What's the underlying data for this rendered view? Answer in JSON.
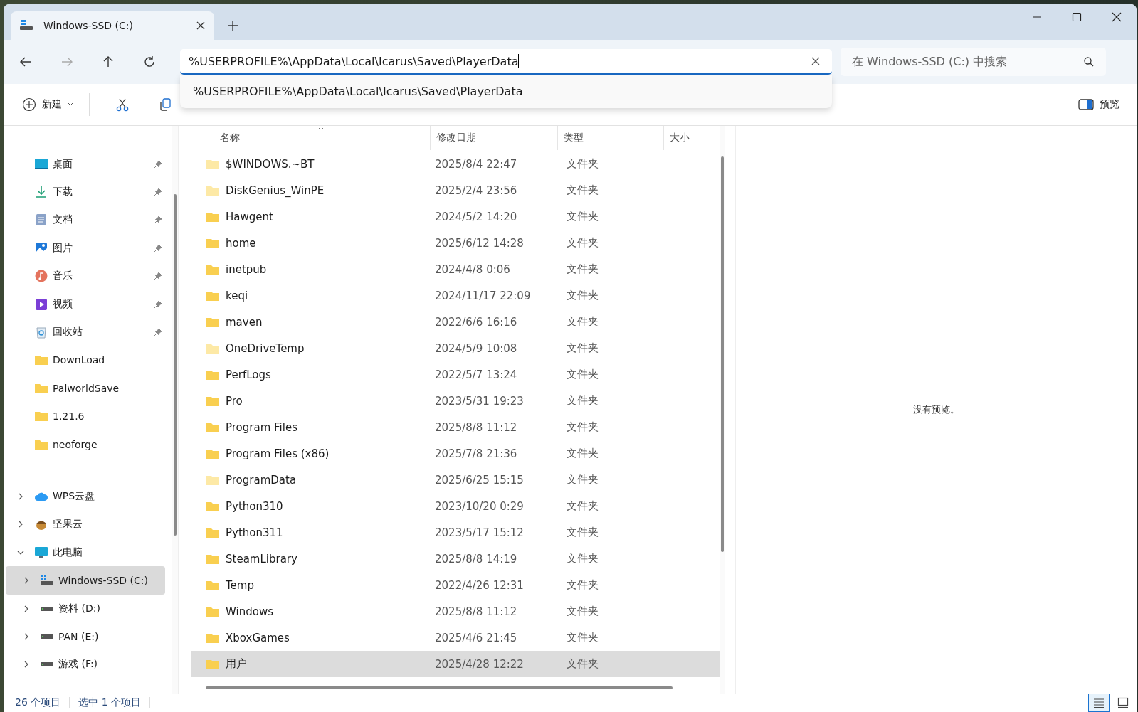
{
  "tabs": [
    {
      "label": "Windows-SSD (C:)",
      "selected": true
    }
  ],
  "address": {
    "value": "%USERPROFILE%\\AppData\\Local\\Icarus\\Saved\\PlayerData",
    "suggestions": [
      "%USERPROFILE%\\AppData\\Local\\Icarus\\Saved\\PlayerData"
    ]
  },
  "search": {
    "placeholder": "在 Windows-SSD (C:) 中搜索"
  },
  "toolbar": {
    "new_label": "新建",
    "preview_label": "预览"
  },
  "quick_access": [
    {
      "label": "桌面",
      "kind": "desktop",
      "pinned": true
    },
    {
      "label": "下载",
      "kind": "download",
      "pinned": true
    },
    {
      "label": "文档",
      "kind": "document",
      "pinned": true
    },
    {
      "label": "图片",
      "kind": "picture",
      "pinned": true
    },
    {
      "label": "音乐",
      "kind": "music",
      "pinned": true
    },
    {
      "label": "视频",
      "kind": "video",
      "pinned": true
    },
    {
      "label": "回收站",
      "kind": "recycle",
      "pinned": true
    },
    {
      "label": "DownLoad",
      "kind": "folder",
      "pinned": false
    },
    {
      "label": "PalworldSave",
      "kind": "folder",
      "pinned": false
    },
    {
      "label": "1.21.6",
      "kind": "folder",
      "pinned": false
    },
    {
      "label": "neoforge",
      "kind": "folder",
      "pinned": false
    }
  ],
  "tree": [
    {
      "label": "WPS云盘",
      "kind": "cloud",
      "expanded": false,
      "selected": false
    },
    {
      "label": "坚果云",
      "kind": "nut",
      "expanded": false,
      "selected": false
    },
    {
      "label": "此电脑",
      "kind": "pc",
      "expanded": true,
      "selected": false,
      "children": [
        {
          "label": "Windows-SSD (C:)",
          "kind": "system-drive",
          "expanded": false,
          "selected": true
        },
        {
          "label": "资料 (D:)",
          "kind": "drive",
          "expanded": false,
          "selected": false
        },
        {
          "label": "PAN (E:)",
          "kind": "drive",
          "expanded": false,
          "selected": false
        },
        {
          "label": "游戏 (F:)",
          "kind": "drive",
          "expanded": false,
          "selected": false
        }
      ]
    }
  ],
  "columns": [
    "名称",
    "修改日期",
    "类型",
    "大小"
  ],
  "rows": [
    {
      "name": "$WINDOWS.~BT",
      "date": "2025/8/4 22:47",
      "type": "文件夹",
      "hidden": true,
      "selected": false
    },
    {
      "name": "DiskGenius_WinPE",
      "date": "2025/2/4 23:56",
      "type": "文件夹",
      "hidden": true,
      "selected": false
    },
    {
      "name": "Hawgent",
      "date": "2024/5/2 14:20",
      "type": "文件夹",
      "hidden": false,
      "selected": false
    },
    {
      "name": "home",
      "date": "2025/6/12 14:28",
      "type": "文件夹",
      "hidden": false,
      "selected": false
    },
    {
      "name": "inetpub",
      "date": "2024/4/8 0:06",
      "type": "文件夹",
      "hidden": false,
      "selected": false
    },
    {
      "name": "keqi",
      "date": "2024/11/17 22:09",
      "type": "文件夹",
      "hidden": false,
      "selected": false
    },
    {
      "name": "maven",
      "date": "2022/6/6 16:16",
      "type": "文件夹",
      "hidden": false,
      "selected": false
    },
    {
      "name": "OneDriveTemp",
      "date": "2024/5/9 10:08",
      "type": "文件夹",
      "hidden": true,
      "selected": false
    },
    {
      "name": "PerfLogs",
      "date": "2022/5/7 13:24",
      "type": "文件夹",
      "hidden": false,
      "selected": false
    },
    {
      "name": "Pro",
      "date": "2023/5/31 19:23",
      "type": "文件夹",
      "hidden": false,
      "selected": false
    },
    {
      "name": "Program Files",
      "date": "2025/8/8 11:12",
      "type": "文件夹",
      "hidden": false,
      "selected": false
    },
    {
      "name": "Program Files (x86)",
      "date": "2025/7/8 21:36",
      "type": "文件夹",
      "hidden": false,
      "selected": false
    },
    {
      "name": "ProgramData",
      "date": "2025/6/25 15:15",
      "type": "文件夹",
      "hidden": true,
      "selected": false
    },
    {
      "name": "Python310",
      "date": "2023/10/20 0:29",
      "type": "文件夹",
      "hidden": false,
      "selected": false
    },
    {
      "name": "Python311",
      "date": "2023/5/17 15:12",
      "type": "文件夹",
      "hidden": false,
      "selected": false
    },
    {
      "name": "SteamLibrary",
      "date": "2025/8/8 14:19",
      "type": "文件夹",
      "hidden": false,
      "selected": false
    },
    {
      "name": "Temp",
      "date": "2022/4/26 12:31",
      "type": "文件夹",
      "hidden": false,
      "selected": false
    },
    {
      "name": "Windows",
      "date": "2025/8/8 11:12",
      "type": "文件夹",
      "hidden": false,
      "selected": false
    },
    {
      "name": "XboxGames",
      "date": "2025/4/6 21:45",
      "type": "文件夹",
      "hidden": false,
      "selected": false
    },
    {
      "name": "用户",
      "date": "2025/4/28 12:22",
      "type": "文件夹",
      "hidden": false,
      "selected": true
    }
  ],
  "preview": {
    "message": "没有预览。"
  },
  "status_bar": {
    "item_count": "26 个项目",
    "selection": "选中 1 个项目"
  },
  "view_buttons": [
    {
      "kind": "details",
      "selected": true
    },
    {
      "kind": "tiles",
      "selected": false
    }
  ]
}
